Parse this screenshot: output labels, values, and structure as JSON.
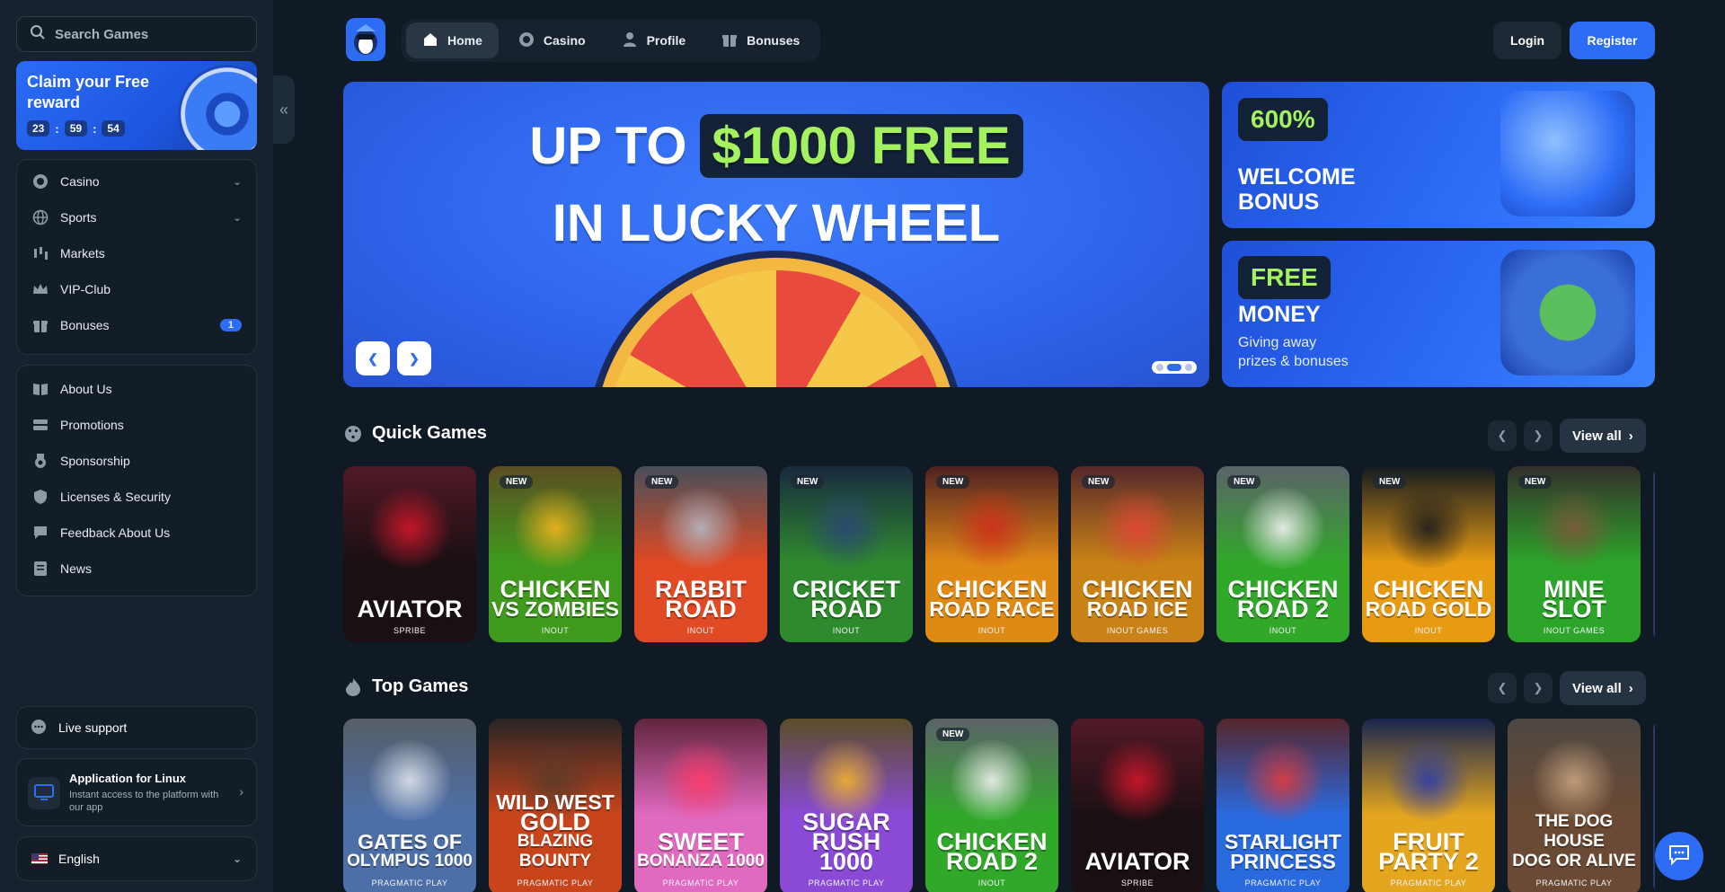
{
  "sidebar": {
    "search_placeholder": "Search Games",
    "reward": {
      "title": "Claim your Free reward",
      "hours": "23",
      "minutes": "59",
      "seconds": "54"
    },
    "menu": [
      {
        "label": "Casino",
        "icon": "casino-chip-icon"
      },
      {
        "label": "Sports",
        "icon": "globe-icon"
      },
      {
        "label": "Markets",
        "icon": "candlestick-icon"
      },
      {
        "label": "VIP-Club",
        "icon": "crown-icon"
      },
      {
        "label": "Bonuses",
        "icon": "gift-icon",
        "badge": "1"
      }
    ],
    "info": [
      {
        "label": "About Us",
        "icon": "book-icon"
      },
      {
        "label": "Promotions",
        "icon": "tickets-icon"
      },
      {
        "label": "Sponsorship",
        "icon": "medal-icon"
      },
      {
        "label": "Licenses & Security",
        "icon": "shield-icon"
      },
      {
        "label": "Feedback About Us",
        "icon": "feedback-icon"
      },
      {
        "label": "News",
        "icon": "newspaper-icon"
      }
    ],
    "live_support": "Live support",
    "app": {
      "title": "Application for Linux",
      "subtitle": "Instant access to the platform with our app"
    },
    "language": "English"
  },
  "header": {
    "tabs": [
      {
        "label": "Home",
        "icon": "home-icon",
        "active": true
      },
      {
        "label": "Casino",
        "icon": "casino-chip-icon",
        "active": false
      },
      {
        "label": "Profile",
        "icon": "user-icon",
        "active": false
      },
      {
        "label": "Bonuses",
        "icon": "gift-icon",
        "active": false
      }
    ],
    "login": "Login",
    "register": "Register"
  },
  "hero": {
    "line1_prefix": "UP TO",
    "line1_highlight": "$1000 FREE",
    "line2": "IN LUCKY WHEEL",
    "prev_icon": "chevron-left-icon",
    "next_icon": "chevron-right-icon",
    "slide_count": 3,
    "active_slide": 2
  },
  "promos": {
    "welcome": {
      "tag": "600%",
      "title_1": "WELCOME",
      "title_2": "BONUS"
    },
    "money": {
      "tag": "FREE",
      "title": "MONEY",
      "sub_1": "Giving away",
      "sub_2": "prizes & bonuses"
    }
  },
  "quick_games": {
    "title": "Quick Games",
    "view_all": "View all",
    "games": [
      {
        "title_1": "AVIATOR",
        "title_2": "",
        "provider": "SPRIBE",
        "new": false,
        "bg": "#1a1013",
        "accent": "#d3172c"
      },
      {
        "title_1": "CHICKEN",
        "title_2": "VS ZOMBIES",
        "provider": "INOUT",
        "new": true,
        "bg": "#3f9a1d",
        "accent": "#f2b51e"
      },
      {
        "title_1": "RABBIT",
        "title_2": "ROAD",
        "provider": "INOUT",
        "new": true,
        "bg": "#e04a24",
        "accent": "#b4b8c4"
      },
      {
        "title_1": "CRICKET",
        "title_2": "ROAD",
        "provider": "INOUT",
        "new": true,
        "bg": "#2f8a2e",
        "accent": "#2a4774"
      },
      {
        "title_1": "CHICKEN",
        "title_2": "ROAD RACE",
        "provider": "INOUT",
        "new": true,
        "bg": "#e08a16",
        "accent": "#d02d1c"
      },
      {
        "title_1": "CHICKEN",
        "title_2": "ROAD ICE",
        "provider": "INOUT GAMES",
        "new": true,
        "bg": "#c98216",
        "accent": "#e24537"
      },
      {
        "title_1": "CHICKEN",
        "title_2": "ROAD 2",
        "provider": "INOUT",
        "new": true,
        "bg": "#32a82b",
        "accent": "#f2f2f2"
      },
      {
        "title_1": "CHICKEN",
        "title_2": "ROAD GOLD",
        "provider": "INOUT",
        "new": true,
        "bg": "#e79b12",
        "accent": "#1c1c1c"
      },
      {
        "title_1": "MINE",
        "title_2": "SLOT",
        "provider": "INOUT GAMES",
        "new": true,
        "bg": "#2ca52a",
        "accent": "#7d5a3a"
      }
    ]
  },
  "top_games": {
    "title": "Top Games",
    "view_all": "View all",
    "games": [
      {
        "title_1": "GATES OF",
        "title_2": "OLYMPUS 1000",
        "provider": "PRAGMATIC PLAY",
        "new": false,
        "bg": "#4d6fa8",
        "accent": "#e2e6ee"
      },
      {
        "title_1": "WILD WEST",
        "title_2": "GOLD",
        "title_3": "BLAZING BOUNTY",
        "provider": "PRAGMATIC PLAY",
        "new": false,
        "bg": "#c8451c",
        "accent": "#5a3a28"
      },
      {
        "title_1": "SWEET",
        "title_2": "BONANZA 1000",
        "provider": "PRAGMATIC PLAY",
        "new": false,
        "bg": "#e06ac0",
        "accent": "#ff3b6b"
      },
      {
        "title_1": "SUGAR",
        "title_2": "RUSH",
        "title_3": "1000",
        "provider": "PRAGMATIC PLAY",
        "new": false,
        "bg": "#8a4ad6",
        "accent": "#f0b52c"
      },
      {
        "title_1": "CHICKEN",
        "title_2": "ROAD 2",
        "provider": "INOUT",
        "new": true,
        "bg": "#32a82b",
        "accent": "#f2f2f2"
      },
      {
        "title_1": "AVIATOR",
        "title_2": "",
        "provider": "SPRIBE",
        "new": false,
        "bg": "#1a1013",
        "accent": "#d3172c"
      },
      {
        "title_1": "STARLIGHT",
        "title_2": "PRINCESS",
        "provider": "PRAGMATIC PLAY",
        "new": false,
        "bg": "#2a6adf",
        "accent": "#e23a3a"
      },
      {
        "title_1": "FRUIT",
        "title_2": "PARTY 2",
        "provider": "PRAGMATIC PLAY",
        "new": false,
        "bg": "#e4a61e",
        "accent": "#2c3ca8"
      },
      {
        "title_1": "THE DOG HOUSE",
        "title_2": "DOG OR ALIVE",
        "provider": "PRAGMATIC PLAY",
        "new": false,
        "bg": "#6a4a34",
        "accent": "#c8a47e"
      }
    ]
  },
  "chat_icon": "chat-bubble-icon",
  "colors": {
    "accent": "#2d6df6",
    "highlight_green": "#a4f25f",
    "background": "#101a24",
    "sidebar": "#17222e"
  }
}
